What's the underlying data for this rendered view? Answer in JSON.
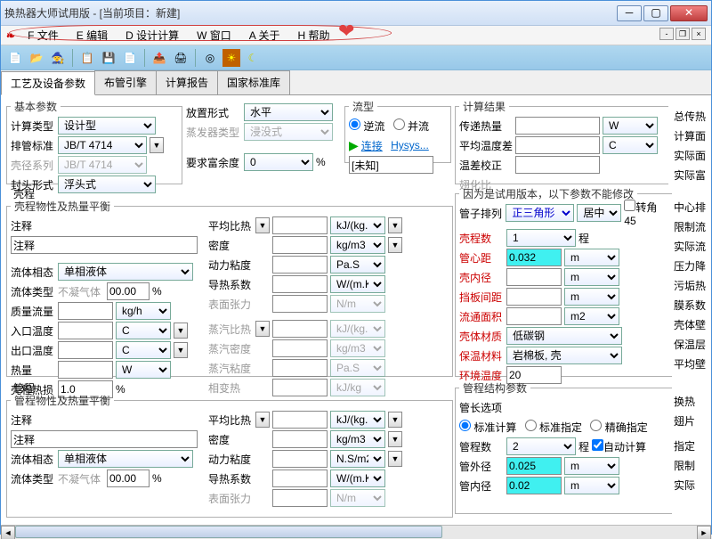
{
  "window": {
    "title": "换热器大师试用版 - [当前项目：新建]"
  },
  "menu": {
    "file": "F 文件",
    "edit": "E 编辑",
    "design": "D 设计计算",
    "window": "W 窗口",
    "about": "A 关于",
    "help": "H 帮助"
  },
  "tabs": {
    "t1": "工艺及设备参数",
    "t2": "布管引擎",
    "t3": "计算报告",
    "t4": "国家标准库"
  },
  "basic": {
    "legend": "基本参数",
    "calc_type_lbl": "计算类型",
    "calc_type": "设计型",
    "pipe_std_lbl": "排管标准",
    "pipe_std": "JB/T 4714",
    "shell_series_lbl": "壳径系列",
    "shell_series": "JB/T 4714",
    "head_type_lbl": "封头形式",
    "head_type": "浮头式",
    "place_lbl": "放置形式",
    "place": "水平",
    "evap_lbl": "蒸发器类型",
    "evap": "浸没式",
    "margin_lbl": "要求富余度",
    "margin": "0",
    "margin_unit": "%"
  },
  "flow": {
    "legend": "流型",
    "counter": "逆流",
    "parallel": "并流",
    "connect": "连接",
    "hysys": "Hysys...",
    "unknown": "[未知]"
  },
  "results": {
    "legend": "计算结果",
    "heat_duty": "传递热量",
    "heat_duty_unit": "W",
    "mean_temp": "平均温度差",
    "mean_temp_unit": "C",
    "temp_corr": "温差校正",
    "u_ratio": "翅化比",
    "total_ht": "总传热",
    "calc_area": "计算面",
    "actual_area": "实际面",
    "actual_margin": "实际富"
  },
  "shell": {
    "title": "壳程",
    "legend": "壳程物性及热量平衡",
    "notes_lbl": "注释",
    "notes": "注释",
    "phase_lbl": "流体相态",
    "phase": "单相液体",
    "type_lbl": "流体类型",
    "noncond": "不凝气体",
    "noncond_v": "00.00",
    "noncond_u": "%",
    "flow_lbl": "质量流量",
    "flow_unit": "kg/h",
    "tin_lbl": "入口温度",
    "tin_unit": "C",
    "tout_lbl": "出口温度",
    "tout_unit": "C",
    "heat_lbl": "热量",
    "heat_unit": "W",
    "hloss_lbl": "壳程热损",
    "hloss_v": "1.0",
    "hloss_u": "%",
    "cp_lbl": "平均比热",
    "cp_unit": "kJ/(kg.K)",
    "den_lbl": "密度",
    "den_unit": "kg/m3",
    "visc_lbl": "动力粘度",
    "visc_unit": "Pa.S",
    "cond_lbl": "导热系数",
    "cond_unit": "W/(m.K)",
    "st_lbl": "表面张力",
    "st_unit": "N/m",
    "vcp_lbl": "蒸汽比热",
    "vcp_unit": "kJ/(kg.K)",
    "vden_lbl": "蒸汽密度",
    "vden_unit": "kg/m3",
    "vvisc_lbl": "蒸汽粘度",
    "vvisc_unit": "Pa.S",
    "relh_lbl": "相变热",
    "relh_unit": "kJ/kg"
  },
  "trial": {
    "legend": "因为是试用版本，以下参数不能修改",
    "arr_lbl": "管子排列",
    "arr": "正三角形",
    "align": "居中",
    "rot45": "转角45",
    "nshells_lbl": "壳程数",
    "nshells": "1",
    "nshells_side": "程",
    "pitch_lbl": "管心距",
    "pitch": "0.032",
    "pitch_unit": "m",
    "shell_id_lbl": "壳内径",
    "shell_id_unit": "m",
    "baffle_lbl": "挡板间距",
    "baffle_unit": "m",
    "area_lbl": "流通面积",
    "area_unit": "m2",
    "mat_lbl": "壳体材质",
    "mat": "低碳钢",
    "ins_lbl": "保温材料",
    "ins": "岩棉板, 壳",
    "env_lbl": "环境温度",
    "env": "20",
    "center": "中心排",
    "limit_flow": "限制流",
    "actual_flow": "实际流",
    "dp": "压力降",
    "foul": "污垢热",
    "film": "膜系数",
    "shell_wall": "壳体壁",
    "ins_layer": "保温层",
    "avg_wall": "平均壁"
  },
  "tube": {
    "title": "管程",
    "legend": "管程物性及热量平衡",
    "notes_lbl": "注释",
    "notes": "注释",
    "phase_lbl": "流体相态",
    "phase": "单相液体",
    "type_lbl": "流体类型",
    "noncond": "不凝气体",
    "noncond_v": "00.00",
    "noncond_u": "%",
    "cp_lbl": "平均比热",
    "cp_unit": "kJ/(kg.K)",
    "den_lbl": "密度",
    "den_unit": "kg/m3",
    "visc_lbl": "动力粘度",
    "visc_unit": "N.S/m2",
    "cond_lbl": "导热系数",
    "cond_unit": "W/(m.K)",
    "st_lbl": "表面张力",
    "st_unit": "N/m"
  },
  "tube_struct": {
    "legend": "管程结构参数",
    "len_opt": "管长选项",
    "std_calc": "标准计算",
    "std_spec": "标准指定",
    "exact_spec": "精确指定",
    "npass_lbl": "管程数",
    "npass": "2",
    "npass_side": "程",
    "auto": "自动计算",
    "od_lbl": "管外径",
    "od": "0.025",
    "od_unit": "m",
    "id_lbl": "管内径",
    "id": "0.02",
    "id_unit": "m",
    "hx": "换热",
    "fin": "翅片",
    "spec": "指定",
    "limit": "限制",
    "actual": "实际"
  }
}
